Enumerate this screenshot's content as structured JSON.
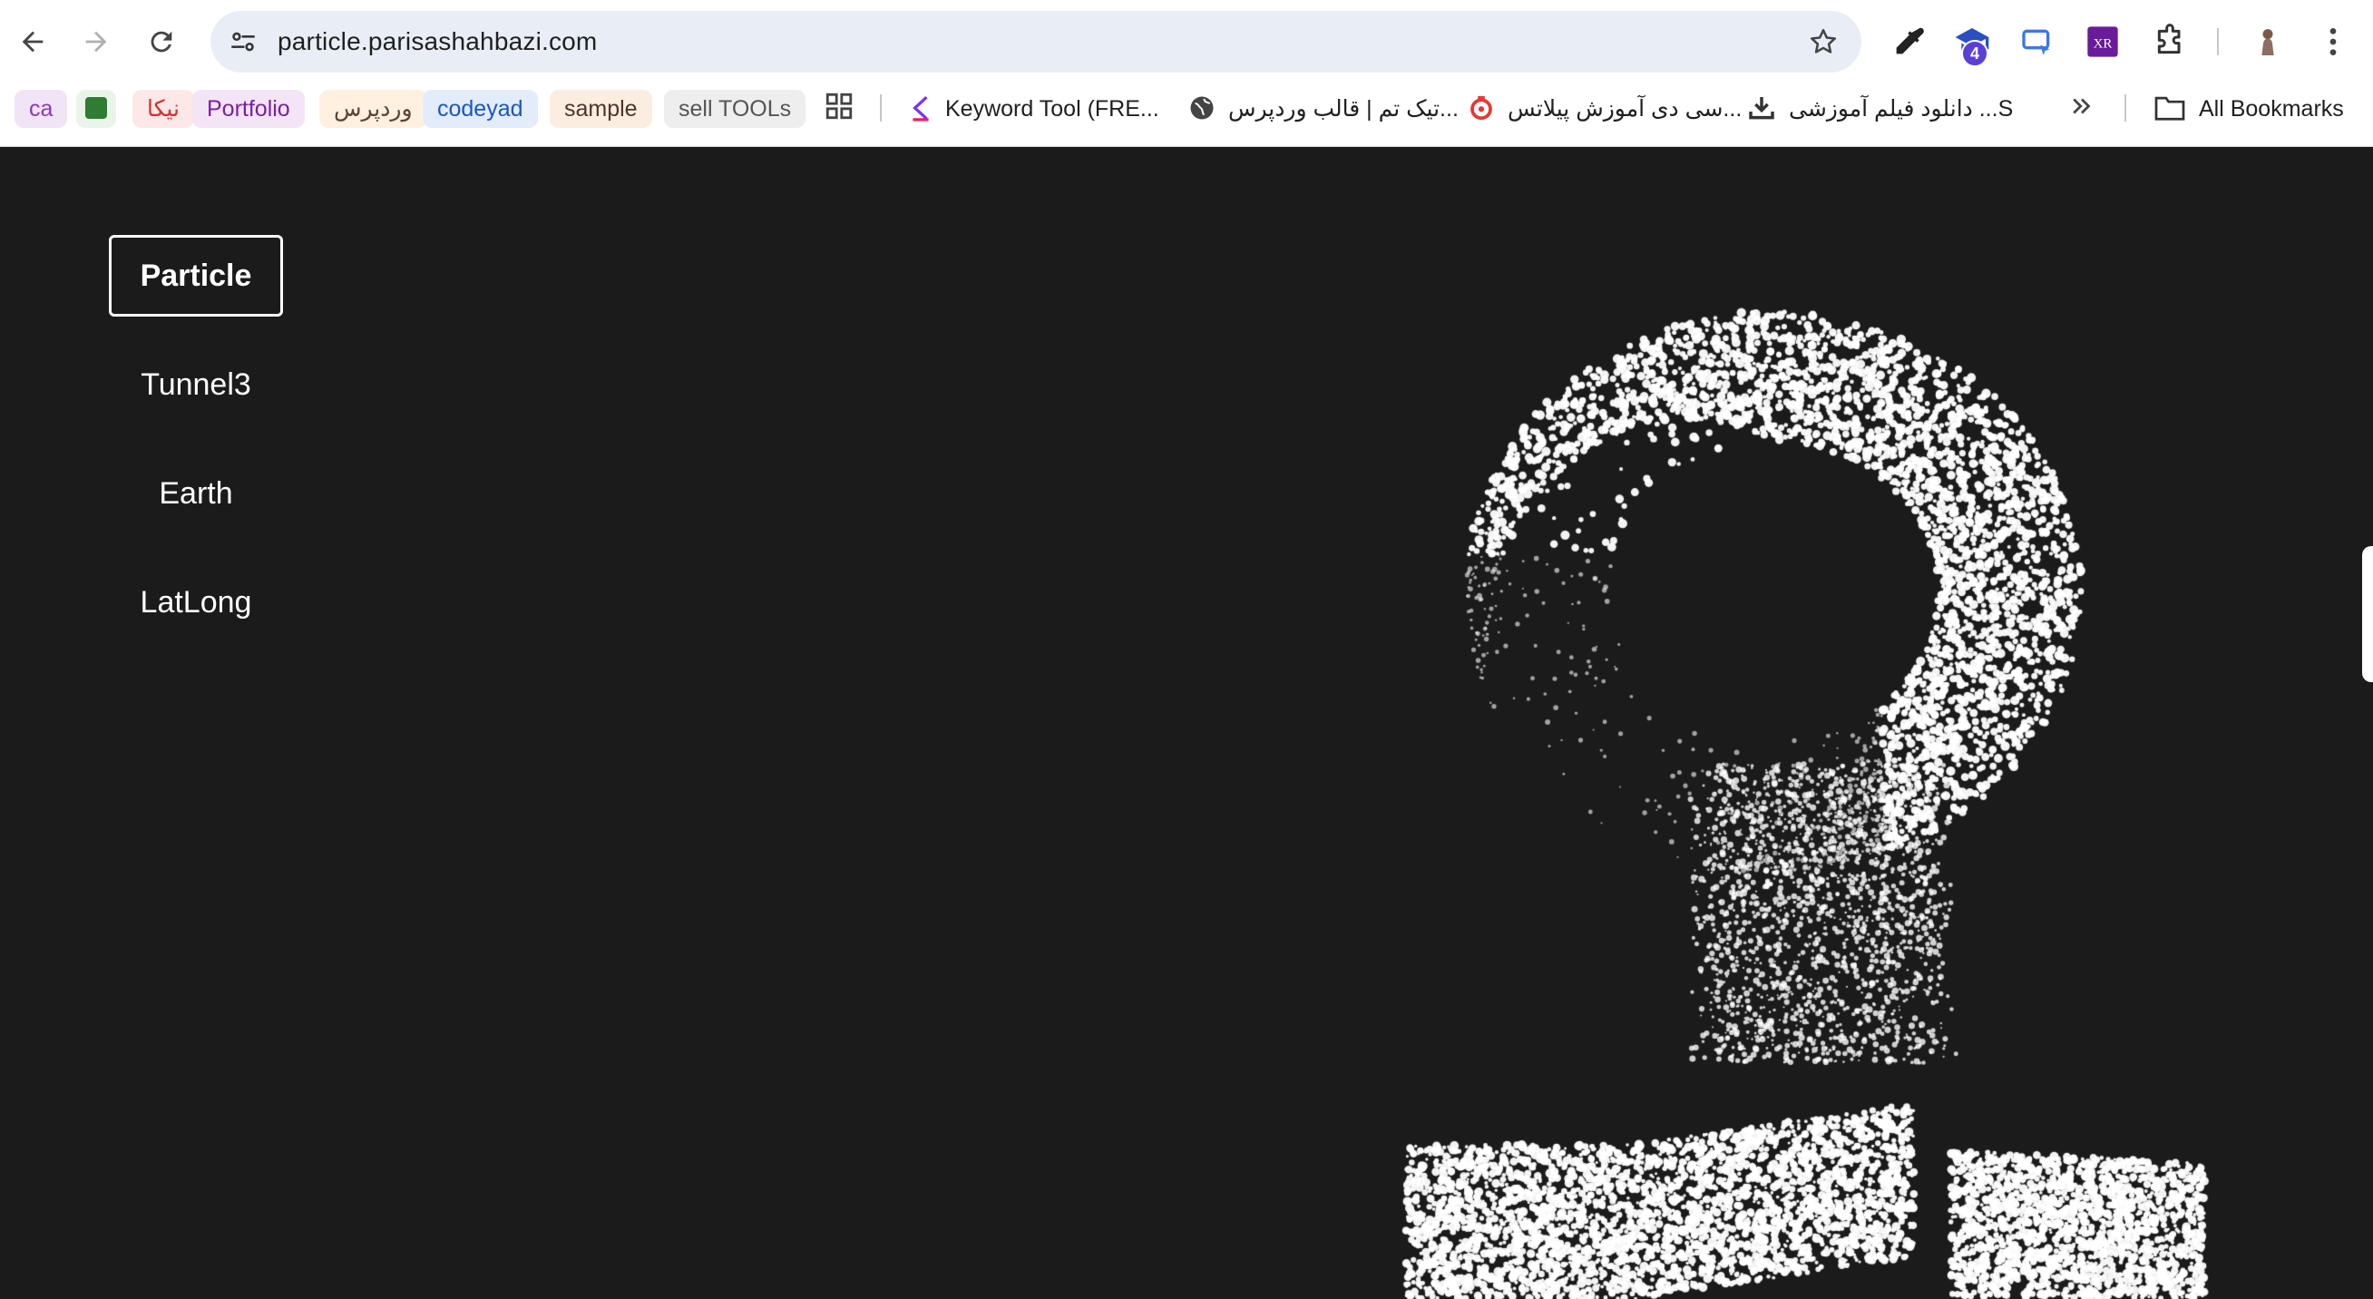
{
  "browser": {
    "url": "particle.parisashahbazi.com",
    "extension_badge": "4",
    "bookmarks": [
      {
        "label": "ca"
      },
      {
        "label": ""
      },
      {
        "label": "نیکا"
      },
      {
        "label": "Portfolio"
      },
      {
        "label": "وردپرس"
      },
      {
        "label": "codeyad"
      },
      {
        "label": "sample"
      },
      {
        "label": "sell TOOLs"
      },
      {
        "label": "Keyword Tool (FRE..."
      },
      {
        "label": "تیک تم | قالب وردپرس..."
      },
      {
        "label": "سی دی آموزش پیلاتس..."
      },
      {
        "label": "دانلود فیلم آموزشی ...S"
      },
      {
        "label": "All Bookmarks"
      }
    ]
  },
  "menu": {
    "items": [
      {
        "label": "Particle",
        "active": true
      },
      {
        "label": "Tunnel3",
        "active": false
      },
      {
        "label": "Earth",
        "active": false
      },
      {
        "label": "LatLong",
        "active": false
      }
    ]
  },
  "colors": {
    "page_background": "#1b1b1b",
    "particle": "#ffffff"
  }
}
